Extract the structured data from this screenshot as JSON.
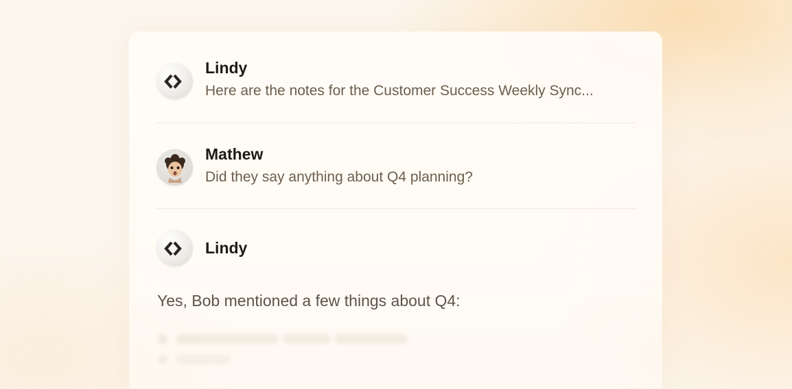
{
  "messages": [
    {
      "sender": "Lindy",
      "avatar_icon": "lindy-logo-icon",
      "text": "Here are the notes for the Customer Success Weekly Sync..."
    },
    {
      "sender": "Mathew",
      "avatar_icon": "user-memoji-avatar",
      "text": "Did they say anything about Q4 planning?"
    },
    {
      "sender": "Lindy",
      "avatar_icon": "lindy-logo-icon",
      "text": "Yes, Bob mentioned a few things about Q4:"
    }
  ],
  "colors": {
    "name": "#1d1a16",
    "message_text": "#6b5e4c",
    "reply_text": "#5c544a",
    "accent_glow": "#fad6a0"
  }
}
